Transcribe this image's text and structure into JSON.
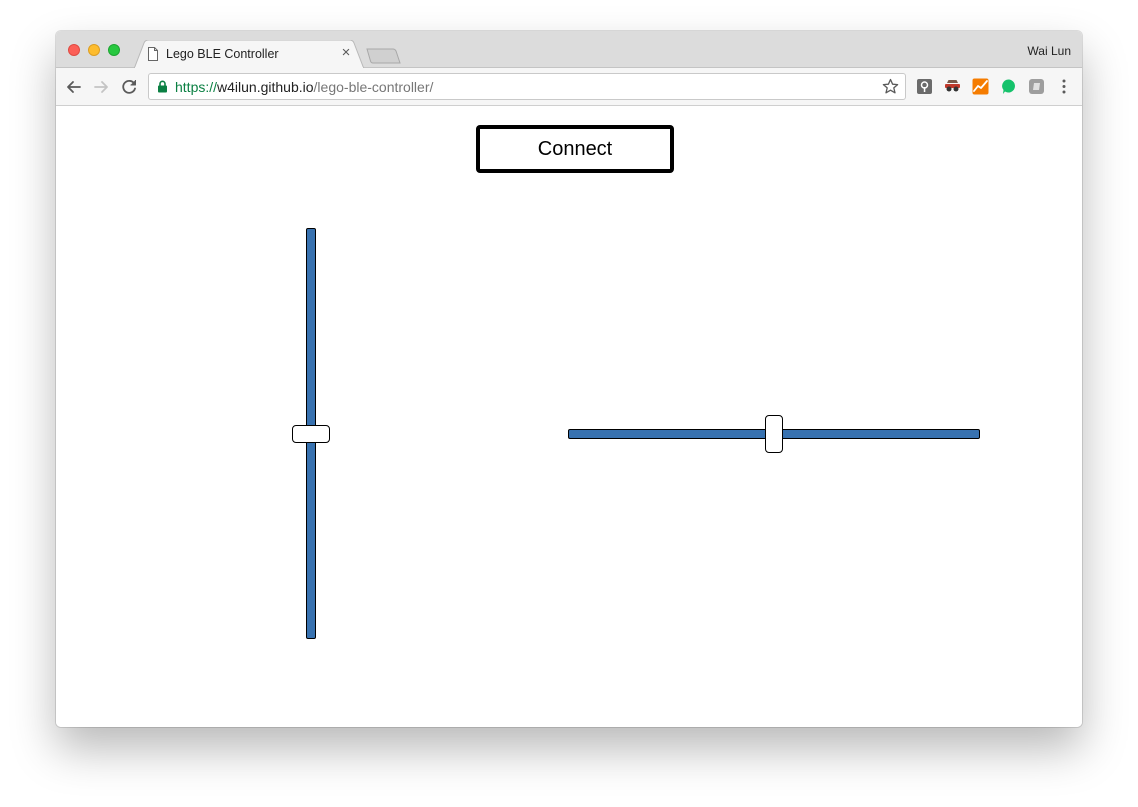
{
  "browser": {
    "tab_title": "Lego BLE Controller",
    "tab_close_symbol": "×",
    "profile_name": "Wai Lun",
    "url_scheme": "https://",
    "url_host": "w4ilun.github.io",
    "url_path": "/lego-ble-controller/",
    "colors": {
      "secure_green": "#0b8043",
      "titlebar": "#dcdcdc"
    },
    "extensions": [
      "keepass-extension-icon",
      "incognito-glasses-extension-icon",
      "analytics-chart-extension-icon",
      "green-speech-bubble-extension-icon",
      "gray-square-extension-icon"
    ]
  },
  "page": {
    "connect_label": "Connect",
    "vertical_slider": {
      "value_fraction": 0.5
    },
    "horizontal_slider": {
      "value_fraction": 0.5
    },
    "colors": {
      "track": "#3872b0",
      "thumb": "#ffffff",
      "border": "#000000"
    }
  }
}
